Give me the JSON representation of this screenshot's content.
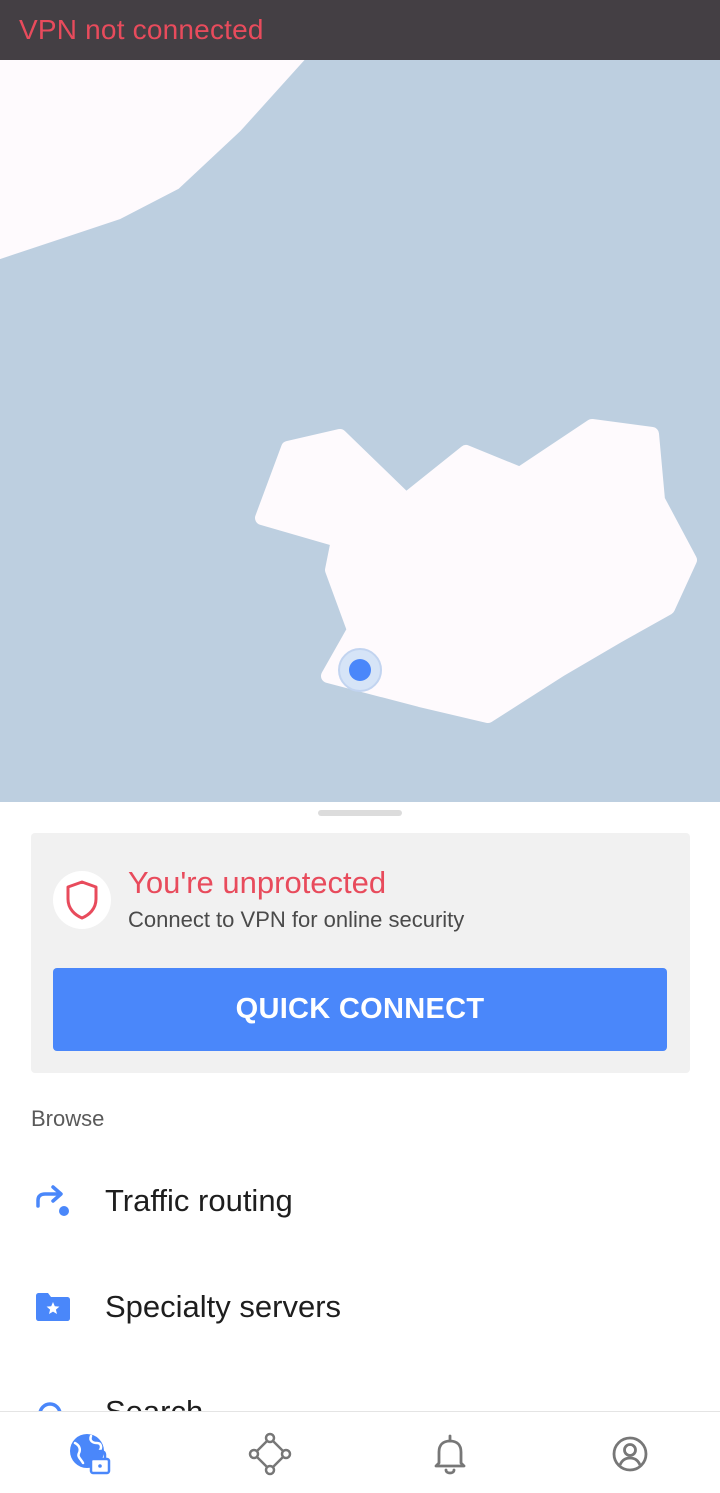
{
  "status_bar": {
    "text": "VPN not connected",
    "color": "#e84b5c",
    "background": "#443f44"
  },
  "map": {
    "water_color": "#bdcfe0",
    "land_color": "#fefafd",
    "location_marker": "location-dot"
  },
  "protection_card": {
    "icon": "shield-icon",
    "title": "You're unprotected",
    "subtitle": "Connect to VPN for online security",
    "quick_connect_label": "QUICK CONNECT",
    "accent": "#4a87fa",
    "warning_color": "#e84b5c"
  },
  "browse": {
    "section_label": "Browse",
    "items": [
      {
        "label": "Traffic routing",
        "icon": "traffic-routing-icon"
      },
      {
        "label": "Specialty servers",
        "icon": "specialty-servers-folder-icon"
      },
      {
        "label": "Search",
        "icon": "search-icon"
      }
    ]
  },
  "bottom_nav": {
    "items": [
      {
        "name": "vpn-globe-lock-icon",
        "active": true
      },
      {
        "name": "meshnet-icon",
        "active": false
      },
      {
        "name": "notifications-bell-icon",
        "active": false
      },
      {
        "name": "profile-icon",
        "active": false
      }
    ]
  }
}
